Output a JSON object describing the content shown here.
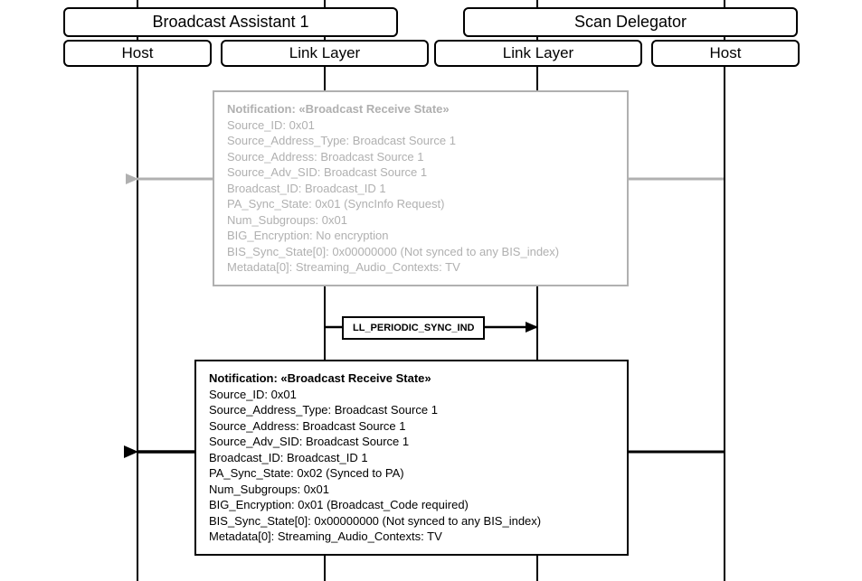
{
  "participants": {
    "ba1": {
      "title": "Broadcast Assistant 1",
      "host": "Host",
      "link": "Link Layer"
    },
    "sd": {
      "title": "Scan Delegator",
      "host": "Host",
      "link": "Link Layer"
    }
  },
  "notif1": {
    "title": "Notification: «Broadcast Receive State»",
    "lines": [
      "Source_ID: 0x01",
      "Source_Address_Type: Broadcast Source 1",
      "Source_Address: Broadcast Source 1",
      "Source_Adv_SID: Broadcast Source 1",
      "Broadcast_ID: Broadcast_ID 1",
      "PA_Sync_State: 0x01 (SyncInfo Request)",
      "Num_Subgroups: 0x01",
      "BIG_Encryption: No encryption",
      "BIS_Sync_State[0]: 0x00000000 (Not synced to any BIS_index)",
      "Metadata[0]: Streaming_Audio_Contexts: TV"
    ]
  },
  "msg1": {
    "label": "LL_PERIODIC_SYNC_IND"
  },
  "notif2": {
    "title": "Notification: «Broadcast Receive State»",
    "lines": [
      "Source_ID: 0x01",
      "Source_Address_Type: Broadcast Source 1",
      "Source_Address: Broadcast Source 1",
      "Source_Adv_SID: Broadcast Source 1",
      "Broadcast_ID: Broadcast_ID 1",
      "PA_Sync_State: 0x02 (Synced to PA)",
      "Num_Subgroups: 0x01",
      "BIG_Encryption: 0x01 (Broadcast_Code required)",
      "BIS_Sync_State[0]: 0x00000000 (Not synced to any BIS_index)",
      "Metadata[0]: Streaming_Audio_Contexts: TV"
    ]
  },
  "chart_data": {
    "type": "table",
    "description": "UML-style sequence diagram with two participants (Broadcast Assistant 1 and Scan Delegator), each split into Host and Link Layer lifelines. Two Notification: «Broadcast Receive State» boxes flow right-to-left from Scan Delegator Host to Broadcast Assistant 1 Host; between them an LL_PERIODIC_SYNC_IND message flows left-to-right between the two Link Layer lifelines.",
    "participants": [
      {
        "name": "Broadcast Assistant 1",
        "lifelines": [
          "Host",
          "Link Layer"
        ]
      },
      {
        "name": "Scan Delegator",
        "lifelines": [
          "Link Layer",
          "Host"
        ]
      }
    ],
    "messages": [
      {
        "from": "Scan Delegator / Host",
        "to": "Broadcast Assistant 1 / Host",
        "label": "Notification: «Broadcast Receive State»",
        "style": "faded",
        "payload": {
          "Source_ID": "0x01",
          "Source_Address_Type": "Broadcast Source 1",
          "Source_Address": "Broadcast Source 1",
          "Source_Adv_SID": "Broadcast Source 1",
          "Broadcast_ID": "Broadcast_ID 1",
          "PA_Sync_State": "0x01 (SyncInfo Request)",
          "Num_Subgroups": "0x01",
          "BIG_Encryption": "No encryption",
          "BIS_Sync_State[0]": "0x00000000 (Not synced to any BIS_index)",
          "Metadata[0]": "Streaming_Audio_Contexts: TV"
        }
      },
      {
        "from": "Broadcast Assistant 1 / Link Layer",
        "to": "Scan Delegator / Link Layer",
        "label": "LL_PERIODIC_SYNC_IND",
        "style": "solid"
      },
      {
        "from": "Scan Delegator / Host",
        "to": "Broadcast Assistant 1 / Host",
        "label": "Notification: «Broadcast Receive State»",
        "style": "solid",
        "payload": {
          "Source_ID": "0x01",
          "Source_Address_Type": "Broadcast Source 1",
          "Source_Address": "Broadcast Source 1",
          "Source_Adv_SID": "Broadcast Source 1",
          "Broadcast_ID": "Broadcast_ID 1",
          "PA_Sync_State": "0x02 (Synced to PA)",
          "Num_Subgroups": "0x01",
          "BIG_Encryption": "0x01 (Broadcast_Code required)",
          "BIS_Sync_State[0]": "0x00000000 (Not synced to any BIS_index)",
          "Metadata[0]": "Streaming_Audio_Contexts: TV"
        }
      }
    ]
  }
}
